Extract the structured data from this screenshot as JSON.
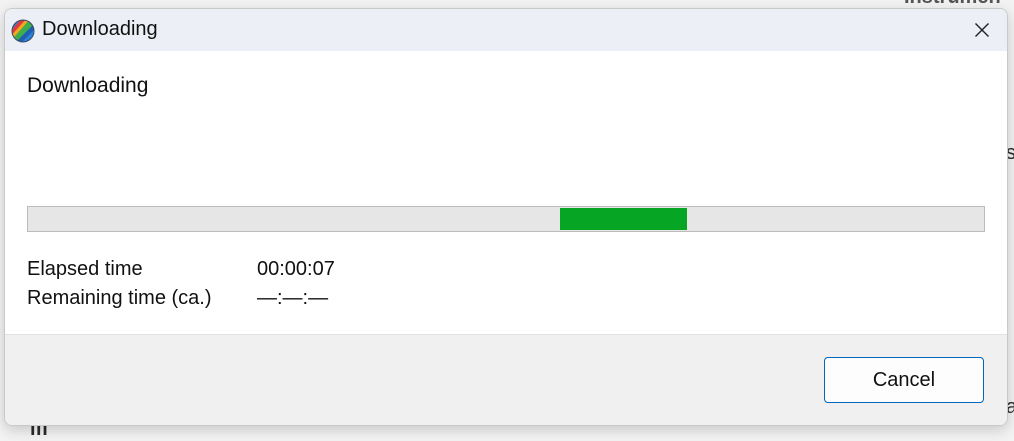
{
  "background": {
    "top_right_fragment": "Instrumen",
    "right_fragment": "s",
    "bottom_left_fragment": "ifi",
    "bottom_right_fragment": "a"
  },
  "window": {
    "title": "Downloading",
    "icon": "app-logo-icon",
    "close_icon": "close-icon"
  },
  "content": {
    "heading": "Downloading",
    "progress": {
      "mode": "indeterminate",
      "indicator_color": "#06a523"
    },
    "elapsed_label": "Elapsed time",
    "elapsed_value": "00:00:07",
    "remaining_label": "Remaining time (ca.)",
    "remaining_value": "—:—:—"
  },
  "footer": {
    "cancel_label": "Cancel"
  }
}
